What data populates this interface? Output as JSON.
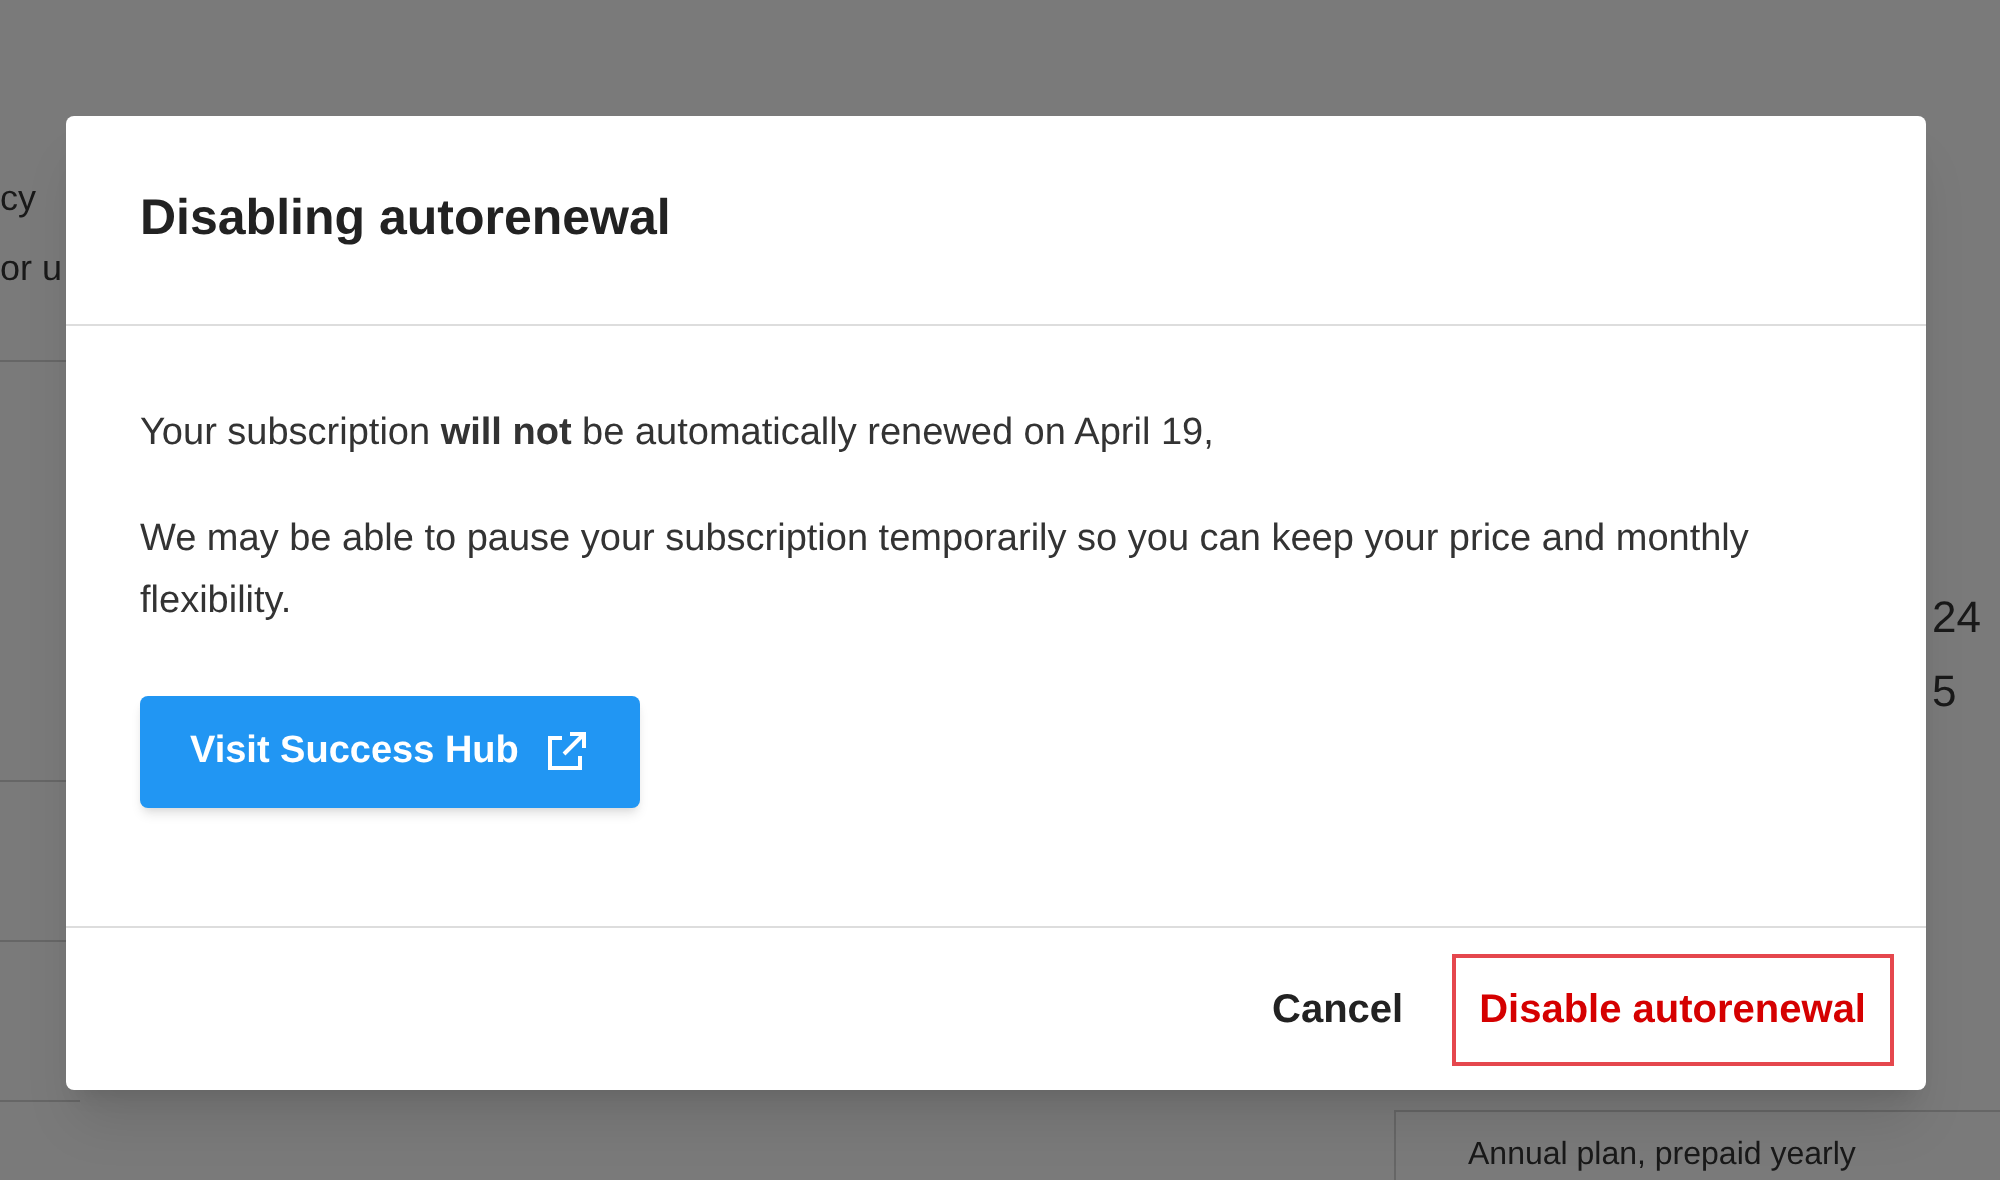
{
  "background": {
    "left_fragments": [
      "cy",
      "or u"
    ],
    "right_fragments": [
      "24",
      "5"
    ],
    "bottom_text": "Annual plan, prepaid yearly"
  },
  "dialog": {
    "title": "Disabling autorenewal",
    "paragraphs": [
      "Your subscription **will not** be automatically renewed on April 19,",
      "We may be able to pause your subscription temporarily so you can keep your price and monthly flexibility."
    ],
    "link_button": {
      "label": "Visit Success Hub"
    },
    "buttons": [
      {
        "label": "Cancel",
        "kind": "secondary",
        "focused": false
      },
      {
        "label": "Disable autorenewal",
        "kind": "danger",
        "focused": true
      }
    ]
  }
}
